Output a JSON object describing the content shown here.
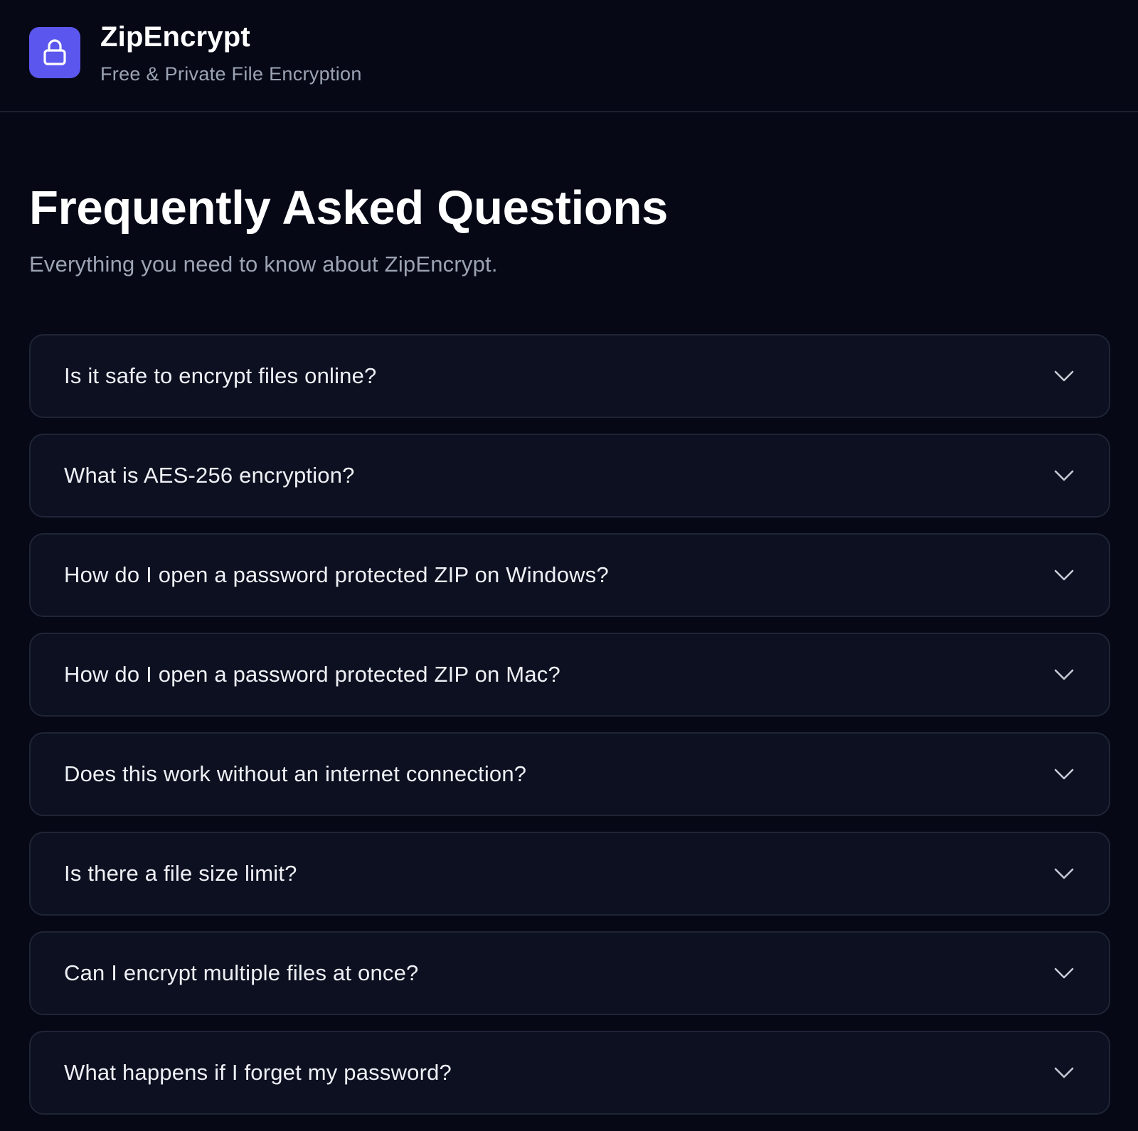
{
  "header": {
    "brand_name": "ZipEncrypt",
    "tagline": "Free & Private File Encryption",
    "logo_icon": "lock-icon",
    "accent_color": "#5b57ee"
  },
  "main": {
    "title": "Frequently Asked Questions",
    "subtitle": "Everything you need to know about ZipEncrypt.",
    "faq_items": [
      {
        "question": "Is it safe to encrypt files online?",
        "icon": "chevron-down-icon"
      },
      {
        "question": "What is AES-256 encryption?",
        "icon": "chevron-down-icon"
      },
      {
        "question": "How do I open a password protected ZIP on Windows?",
        "icon": "chevron-down-icon"
      },
      {
        "question": "How do I open a password protected ZIP on Mac?",
        "icon": "chevron-down-icon"
      },
      {
        "question": "Does this work without an internet connection?",
        "icon": "chevron-down-icon"
      },
      {
        "question": "Is there a file size limit?",
        "icon": "chevron-down-icon"
      },
      {
        "question": "Can I encrypt multiple files at once?",
        "icon": "chevron-down-icon"
      },
      {
        "question": "What happens if I forget my password?",
        "icon": "chevron-down-icon"
      }
    ]
  }
}
